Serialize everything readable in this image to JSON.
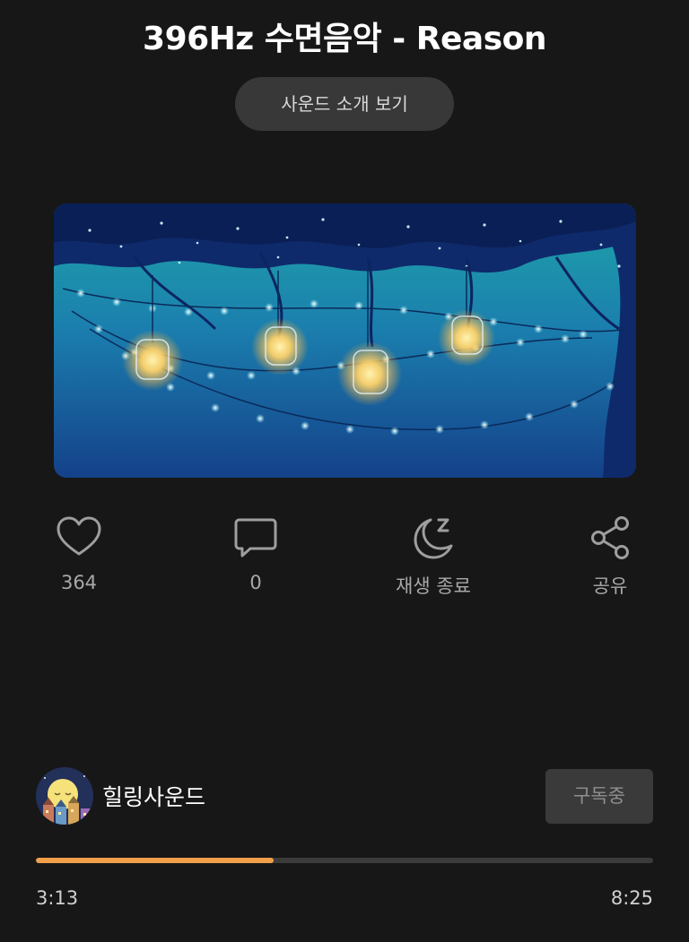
{
  "header": {
    "title": "396Hz 수면음악 - Reason",
    "intro_button": "사운드 소개 보기"
  },
  "actions": {
    "like": {
      "icon": "heart-icon",
      "count": "364"
    },
    "comment": {
      "icon": "comment-icon",
      "count": "0"
    },
    "sleep_timer": {
      "icon": "moon-sleep-icon",
      "label": "재생 종료"
    },
    "share": {
      "icon": "share-icon",
      "label": "공유"
    }
  },
  "channel": {
    "name": "힐링사운드",
    "subscribe_label": "구독중"
  },
  "player": {
    "current_time": "3:13",
    "total_time": "8:25",
    "progress_fraction": 0.385
  },
  "colors": {
    "background": "#171717",
    "accent": "#f0a04b",
    "track": "#3b3b3b"
  }
}
